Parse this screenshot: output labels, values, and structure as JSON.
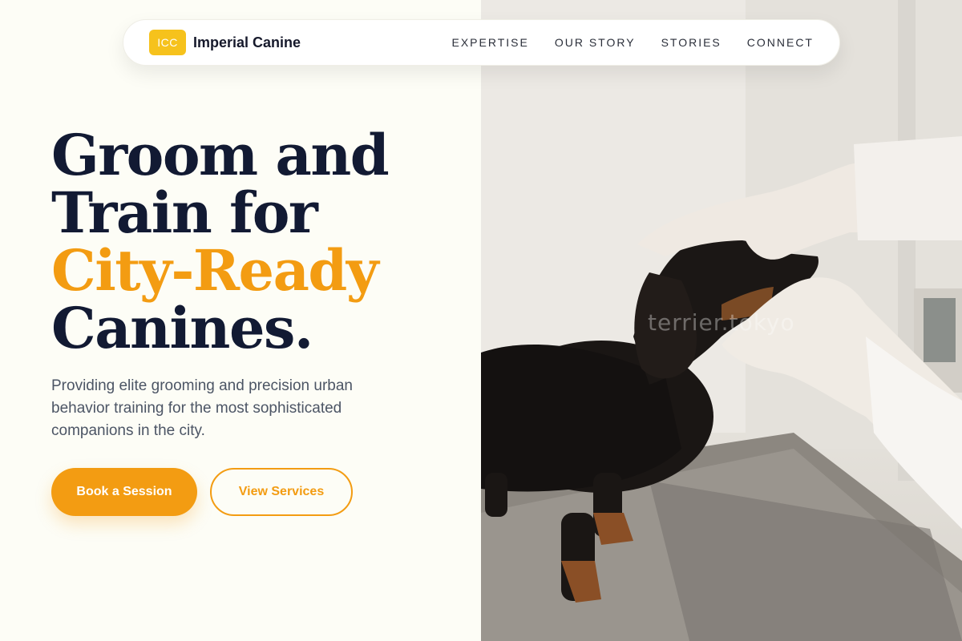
{
  "nav": {
    "logo_badge": "ICC",
    "brand_name": "Imperial Canine",
    "links": [
      "EXPERTISE",
      "OUR STORY",
      "STORIES",
      "CONNECT"
    ]
  },
  "hero": {
    "headline_lines": [
      "Groom and",
      "Train for",
      "City-Ready",
      "Canines."
    ],
    "subtext": "Providing elite grooming and precision urban behavior training for the most sophisticated companions in the city.",
    "primary_cta": "Book a Session",
    "secondary_cta": "View Services"
  },
  "photo": {
    "watermark": "terrier.tokyo"
  },
  "colors": {
    "accent": "#f39c12",
    "badge": "#f6c21c",
    "heading": "#121a33",
    "background": "#fdfdf6"
  }
}
